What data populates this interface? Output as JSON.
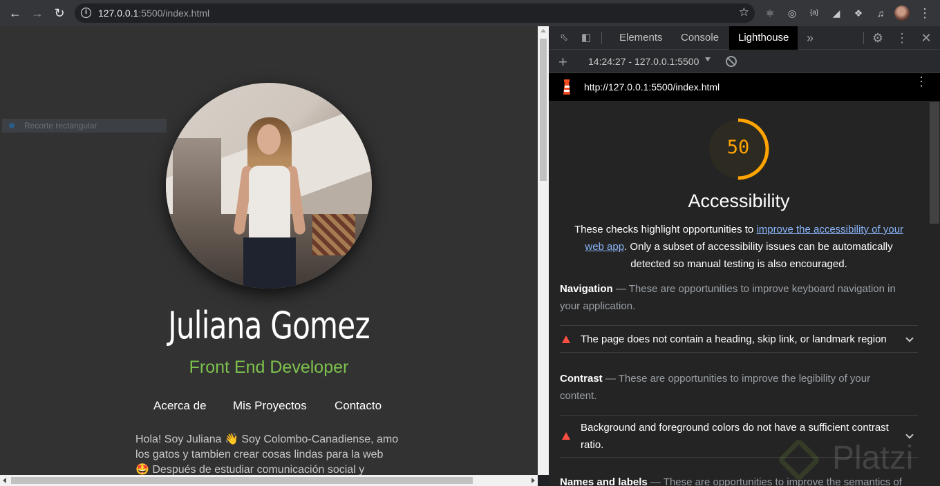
{
  "browser": {
    "url_host": "127.0.0.1",
    "url_rest": ":5500/index.html"
  },
  "page": {
    "snip_overlay": "Recorte rectangular",
    "name": "Juliana Gomez",
    "role": "Front End Developer",
    "menu": [
      "Acerca de",
      "Mis Proyectos",
      "Contacto"
    ],
    "bio_lines": [
      "Hola! Soy Juliana 👋 Soy Colombo-Canadiense, amo",
      "los gatos y tambien crear cosas lindas para la web",
      "🤩 Después de estudiar comunicación social y"
    ],
    "colors": {
      "background": "#323232",
      "role": "#7dc24d"
    }
  },
  "devtools": {
    "tabs": [
      "Elements",
      "Console",
      "Lighthouse"
    ],
    "active_tab": "Lighthouse",
    "run_label": "14:24:27 - 127.0.0.1:5500",
    "report_url": "http://127.0.0.1:5500/index.html",
    "category": {
      "score": "50",
      "score_fraction": 0.5,
      "title": "Accessibility",
      "desc_before": "These checks highlight opportunities to ",
      "desc_link": "improve the accessibility of your web app",
      "desc_after": ". Only a subset of accessibility issues can be automatically detected so manual testing is also encouraged."
    },
    "groups": [
      {
        "title": "Navigation",
        "desc": " — These are opportunities to improve keyboard navigation in your application.",
        "audit": "The page does not contain a heading, skip link, or landmark region"
      },
      {
        "title": "Contrast",
        "desc": " — These are opportunities to improve the legibility of your content.",
        "audit": "Background and foreground colors do not have a sufficient contrast ratio."
      },
      {
        "title": "Names and labels",
        "desc": " — These are opportunities to improve the semantics of"
      }
    ],
    "colors": {
      "score": "#ffa400",
      "fail": "#ff4e42",
      "link": "#8ab4f8"
    }
  },
  "watermark": "Platzi"
}
